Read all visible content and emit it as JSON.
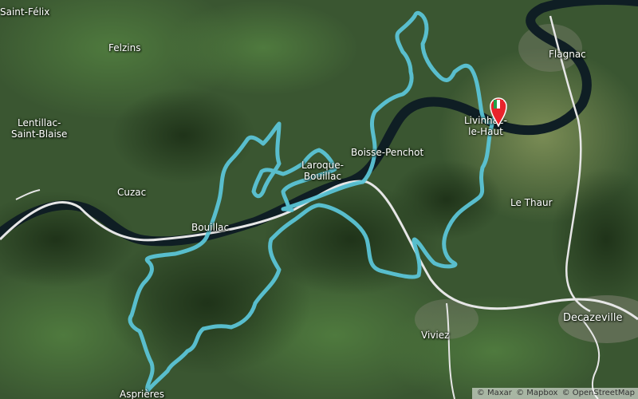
{
  "map": {
    "style": "satellite",
    "route_color": "#5bc4d6",
    "river_color": "#0f1e24",
    "road_color": "#e6e6e6"
  },
  "places": {
    "saint_felix": "Saint-Félix",
    "felzins": "Felzins",
    "lentillac_line1": "Lentillac-",
    "lentillac_line2": "Saint-Blaise",
    "cuzac": "Cuzac",
    "bouillac": "Bouillac",
    "laroque_line1": "Laroque-",
    "laroque_line2": "Bouillac",
    "boisse_penchot": "Boisse-Penchot",
    "livinhac_line1": "Livinhac-",
    "livinhac_line2": "le-Haut",
    "flagnac": "Flagnac",
    "le_thaur": "Le Thaur",
    "viviez": "Viviez",
    "decazeville": "Decazeville",
    "asprieres": "Asprières"
  },
  "marker": {
    "icon": "start-finish-flag-icon",
    "pin_color": "#e8232b"
  },
  "attribution": {
    "maxar": "© Maxar",
    "mapbox": "© Mapbox",
    "osm": "© OpenStreetMap"
  }
}
